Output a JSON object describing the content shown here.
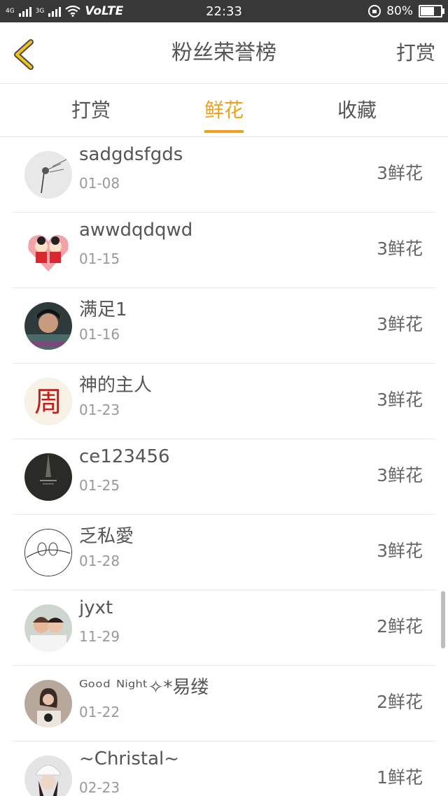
{
  "status_bar": {
    "network1": "4G",
    "network2": "3G",
    "carrier_tag": "VoLTE",
    "time": "22:33",
    "battery": "80%",
    "battery_level": 0.8
  },
  "header": {
    "title": "粉丝荣誉榜",
    "action": "打赏"
  },
  "tabs": [
    {
      "label": "打赏",
      "active": false
    },
    {
      "label": "鲜花",
      "active": true
    },
    {
      "label": "收藏",
      "active": false
    }
  ],
  "accent_color": "#f0a01c",
  "list": [
    {
      "name": "sadgdsfgds",
      "date": "01-08",
      "count": "3鲜花"
    },
    {
      "name": "awwdqdqwd",
      "date": "01-15",
      "count": "3鲜花"
    },
    {
      "name": "满足1",
      "date": "01-16",
      "count": "3鲜花"
    },
    {
      "name": "神的主人",
      "date": "01-23",
      "count": "3鲜花",
      "avatar_char": "周"
    },
    {
      "name": "ce123456",
      "date": "01-25",
      "count": "3鲜花"
    },
    {
      "name": "乏私愛",
      "date": "01-28",
      "count": "3鲜花"
    },
    {
      "name": "jyxt",
      "date": "11-29",
      "count": "2鲜花"
    },
    {
      "name": "ᴳᵒᵒᵈ ᴺⁱᵍʰᵗ✧*易缕",
      "date": "01-22",
      "count": "2鲜花"
    },
    {
      "name": "~Christal~",
      "date": "02-23",
      "count": "1鲜花"
    }
  ]
}
